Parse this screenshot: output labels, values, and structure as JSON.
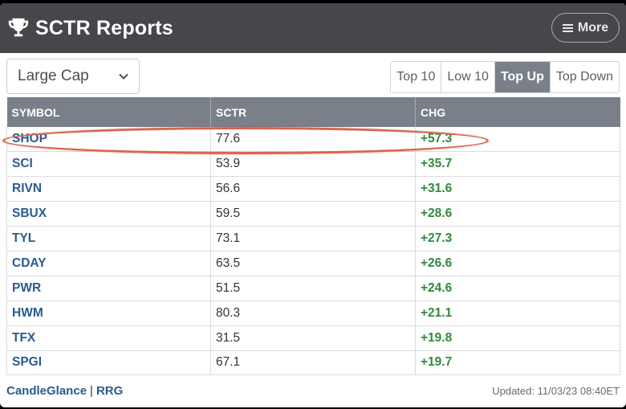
{
  "header": {
    "title": "SCTR Reports",
    "more_label": "More"
  },
  "controls": {
    "cap_select": "Large Cap",
    "tabs": [
      {
        "label": "Top 10",
        "active": false
      },
      {
        "label": "Low 10",
        "active": false
      },
      {
        "label": "Top Up",
        "active": true
      },
      {
        "label": "Top Down",
        "active": false
      }
    ]
  },
  "table": {
    "columns": [
      "SYMBOL",
      "SCTR",
      "CHG"
    ],
    "rows": [
      {
        "symbol": "SHOP",
        "sctr": "77.6",
        "chg": "+57.3"
      },
      {
        "symbol": "SCI",
        "sctr": "53.9",
        "chg": "+35.7"
      },
      {
        "symbol": "RIVN",
        "sctr": "56.6",
        "chg": "+31.6"
      },
      {
        "symbol": "SBUX",
        "sctr": "59.5",
        "chg": "+28.6"
      },
      {
        "symbol": "TYL",
        "sctr": "73.1",
        "chg": "+27.3"
      },
      {
        "symbol": "CDAY",
        "sctr": "63.5",
        "chg": "+26.6"
      },
      {
        "symbol": "PWR",
        "sctr": "51.5",
        "chg": "+24.6"
      },
      {
        "symbol": "HWM",
        "sctr": "80.3",
        "chg": "+21.1"
      },
      {
        "symbol": "TFX",
        "sctr": "31.5",
        "chg": "+19.8"
      },
      {
        "symbol": "SPGI",
        "sctr": "67.1",
        "chg": "+19.7"
      }
    ]
  },
  "footer": {
    "link_candleglance": "CandleGlance",
    "separator": "|",
    "link_rrg": "RRG",
    "updated": "Updated: 11/03/23 08:40ET"
  },
  "colors": {
    "header_bg": "#46474b",
    "table_header_bg": "#7a8089",
    "symbol_blue": "#2b5b8f",
    "change_green": "#2e8a3e",
    "highlight_red": "#d9644f"
  }
}
